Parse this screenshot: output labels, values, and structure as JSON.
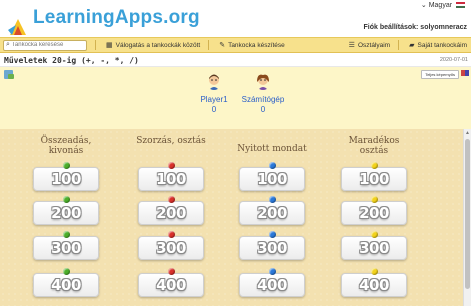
{
  "header": {
    "logo_text": "LearningApps.org",
    "language": "Magyar",
    "account": "Fiók beállítások: solyomneracz"
  },
  "nav": {
    "search_placeholder": "Tankocka keresése",
    "items": [
      {
        "label": "Válogatás a tankockák között",
        "icon": "grid-icon"
      },
      {
        "label": "Tankocka készítése",
        "icon": "pencil-icon"
      },
      {
        "label": "Osztályaim",
        "icon": "list-icon"
      },
      {
        "label": "Saját tankockáim",
        "icon": "folder-icon"
      }
    ]
  },
  "page": {
    "title": "Műveletek 20-ig (+, -, *, /)",
    "date": "2020-07-01",
    "fullscreen_label": "Teljes képernyős"
  },
  "players": [
    {
      "name": "Player1",
      "score": "0",
      "icon": "boy-avatar-icon"
    },
    {
      "name": "Számítógép",
      "score": "0",
      "icon": "girl-avatar-icon"
    }
  ],
  "board": {
    "categories": [
      {
        "title": "Összeadás, kivonás",
        "pin_color": "#4caf2a"
      },
      {
        "title": "Szorzás, osztás",
        "pin_color": "#d9302a"
      },
      {
        "title": "Nyitott mondat",
        "pin_color": "#2a78d9"
      },
      {
        "title": "Maradékos osztás",
        "pin_color": "#f2d21a"
      }
    ],
    "values": [
      "100",
      "200",
      "300",
      "400"
    ]
  }
}
